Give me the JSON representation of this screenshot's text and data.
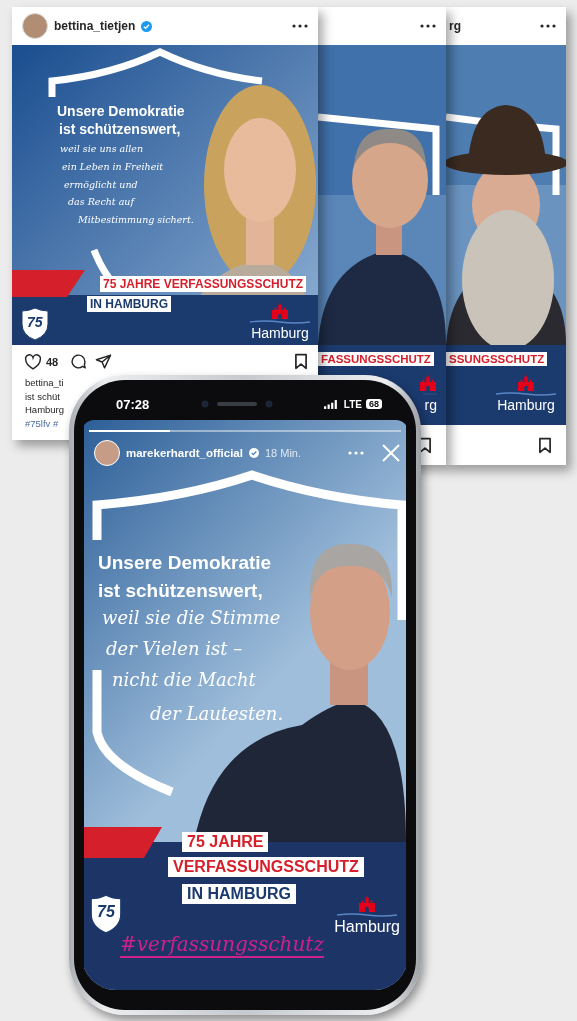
{
  "posts": [
    {
      "username": "bettina_tietjen",
      "verified": true,
      "image": {
        "kind": "picture",
        "headline": [
          "Unsere Demokratie",
          "ist schützenswert,"
        ],
        "quote": [
          "weil sie uns allen",
          "ein Leben in Freiheit",
          "ermöglicht und",
          "das Recht auf",
          "Mitbestimmung sichert."
        ],
        "banner": [
          "75 JAHRE VERFASSUNGSSCHUTZ",
          "IN HAMBURG"
        ],
        "logo_number": "75",
        "city": "Hamburg"
      },
      "likes": "48",
      "caption": [
        {
          "kind": "text",
          "text": "bettina_ti"
        },
        {
          "kind": "text",
          "text": "ist schüt"
        },
        {
          "kind": "text",
          "text": "Hamburg"
        },
        {
          "kind": "hashtags",
          "text": "#75lfv #"
        }
      ]
    },
    {
      "image": {
        "kind": "picture",
        "banner": [
          "FASSUNGSSCHUTZ"
        ],
        "city": "rg"
      }
    },
    {
      "username": "rg",
      "image": {
        "kind": "picture",
        "banner": [
          "SSUNGSSCHUTZ"
        ],
        "city": "Hamburg"
      }
    }
  ],
  "story": {
    "time": "07:28",
    "network": "LTE",
    "battery": "68",
    "progress": {
      "level": 0.26
    },
    "username": "marekerhardt_official",
    "verified": true,
    "age": "18 Min.",
    "image": {
      "kind": "picture",
      "headline": [
        "Unsere Demokratie",
        "ist schützenswert,"
      ],
      "quote": [
        "weil sie die Stimme",
        "der Vielen ist –",
        "nicht die Macht",
        "der Lautesten."
      ],
      "banner": [
        "75 JAHRE",
        "VERFASSUNGSSCHUTZ",
        "IN HAMBURG"
      ],
      "logo_number": "75",
      "city": "Hamburg",
      "hashtag": "#verfassungsschutz"
    }
  }
}
